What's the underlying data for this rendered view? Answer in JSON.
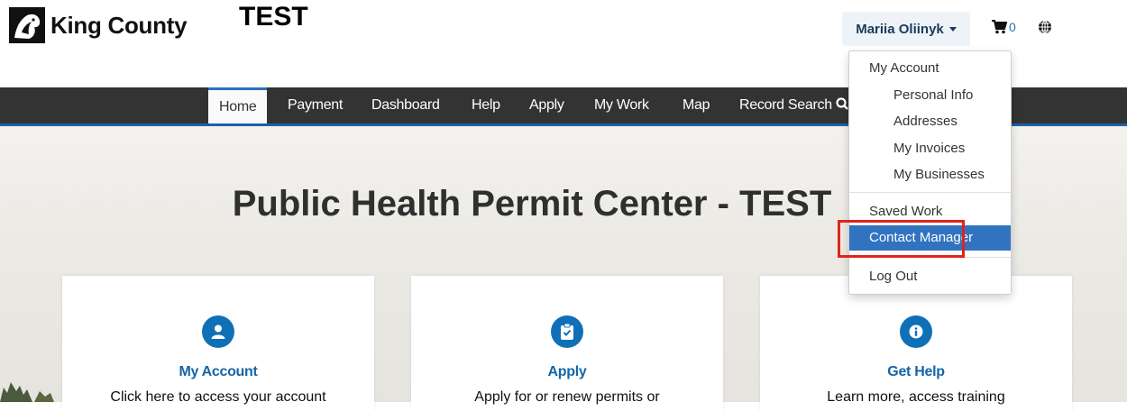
{
  "brand": {
    "name": "King County",
    "env_label": "TEST"
  },
  "header": {
    "user_name": "Mariia Oliinyk",
    "cart_count": "0"
  },
  "nav": {
    "items": [
      {
        "label": "Home",
        "active": true
      },
      {
        "label": "Payment"
      },
      {
        "label": "Dashboard"
      },
      {
        "label": "Help"
      },
      {
        "label": "Apply"
      },
      {
        "label": "My Work"
      },
      {
        "label": "Map"
      },
      {
        "label": "Record Search"
      }
    ]
  },
  "hero": {
    "title": "Public Health Permit Center - TEST"
  },
  "cards": [
    {
      "title": "My Account",
      "desc": "Click here to access your account"
    },
    {
      "title": "Apply",
      "desc": "Apply for or renew permits or"
    },
    {
      "title": "Get Help",
      "desc": "Learn more, access training"
    }
  ],
  "dropdown": {
    "my_account": "My Account",
    "personal_info": "Personal Info",
    "addresses": "Addresses",
    "my_invoices": "My Invoices",
    "my_businesses": "My Businesses",
    "saved_work": "Saved Work",
    "contact_manager": "Contact Manager",
    "log_out": "Log Out"
  },
  "colors": {
    "accent": "#3273c0",
    "navbar": "#333333",
    "icon_blue": "#0f70b7",
    "highlight_border": "#e2231a"
  }
}
